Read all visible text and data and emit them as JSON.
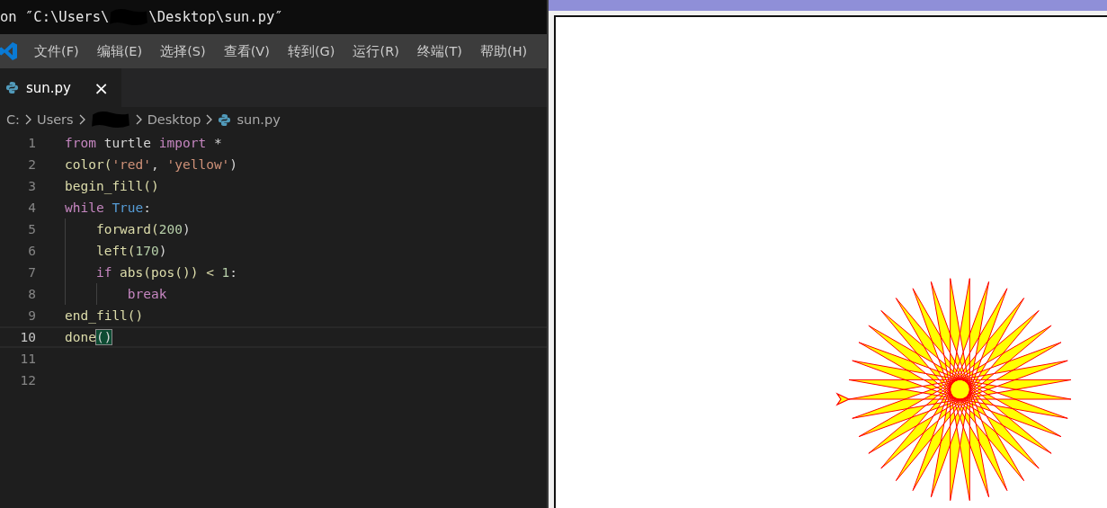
{
  "window": {
    "title_start": "on ″C:\\Users\\",
    "title_end": "\\Desktop\\sun.py″"
  },
  "menu": [
    "文件(F)",
    "编辑(E)",
    "选择(S)",
    "查看(V)",
    "转到(G)",
    "运行(R)",
    "终端(T)",
    "帮助(H)"
  ],
  "tabs": [
    {
      "label": "sun.py",
      "selected": true,
      "close": "×"
    }
  ],
  "breadcrumb": [
    {
      "label": "C:",
      "kind": "text"
    },
    {
      "label": "Users",
      "kind": "text"
    },
    {
      "kind": "redacted"
    },
    {
      "label": "Desktop",
      "kind": "text"
    },
    {
      "label": "sun.py",
      "kind": "file"
    }
  ],
  "editor": {
    "lines": [
      {
        "number": "1",
        "current": false,
        "tokens": [
          {
            "text": "from",
            "kind": "keyword"
          },
          {
            "text": " turtle ",
            "kind": "plain"
          },
          {
            "text": "import",
            "kind": "keyword"
          },
          {
            "text": " *",
            "kind": "plain"
          }
        ]
      },
      {
        "number": "2",
        "current": false,
        "tokens": [
          {
            "text": "color(",
            "kind": "function"
          },
          {
            "text": "'red'",
            "kind": "string"
          },
          {
            "text": ", ",
            "kind": "plain"
          },
          {
            "text": "'yellow'",
            "kind": "string"
          },
          {
            "text": ")",
            "kind": "plain"
          }
        ]
      },
      {
        "number": "3",
        "current": false,
        "tokens": [
          {
            "text": "begin_fill()",
            "kind": "function"
          }
        ]
      },
      {
        "number": "4",
        "current": false,
        "tokens": [
          {
            "text": "while",
            "kind": "keyword"
          },
          {
            "text": " True",
            "kind": "constant"
          },
          {
            "text": ":",
            "kind": "plain"
          }
        ]
      },
      {
        "number": "5",
        "current": false,
        "tokens": [
          {
            "text": "    forward(",
            "kind": "function"
          },
          {
            "text": "200",
            "kind": "number"
          },
          {
            "text": ")",
            "kind": "plain"
          }
        ]
      },
      {
        "number": "6",
        "current": false,
        "tokens": [
          {
            "text": "    left(",
            "kind": "function"
          },
          {
            "text": "170",
            "kind": "number"
          },
          {
            "text": ")",
            "kind": "plain"
          }
        ]
      },
      {
        "number": "7",
        "current": false,
        "tokens": [
          {
            "text": "    if",
            "kind": "keyword"
          },
          {
            "text": " abs(pos()) < ",
            "kind": "function"
          },
          {
            "text": "1",
            "kind": "number"
          },
          {
            "text": ":",
            "kind": "plain"
          }
        ]
      },
      {
        "number": "8",
        "current": false,
        "tokens": [
          {
            "text": "        break",
            "kind": "keyword"
          }
        ]
      },
      {
        "number": "9",
        "current": false,
        "tokens": [
          {
            "text": "end_fill()",
            "kind": "function"
          }
        ]
      },
      {
        "number": "10",
        "current": true,
        "tokens": [
          {
            "text": "done",
            "kind": "function"
          },
          {
            "text": "()",
            "kind": "bracket-match"
          }
        ]
      },
      {
        "number": "11",
        "current": false
      },
      {
        "number": "12",
        "current": false
      }
    ]
  },
  "turtle_window": {
    "kind": "turtle-canvas"
  }
}
